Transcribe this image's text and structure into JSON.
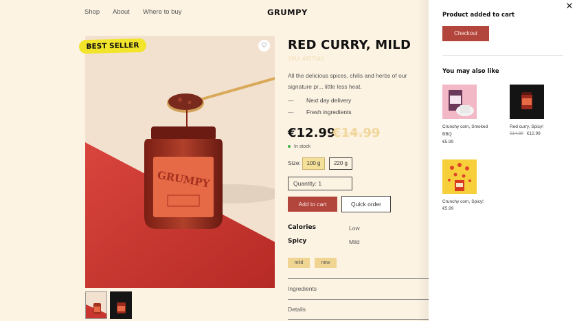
{
  "nav": {
    "links": [
      "Shop",
      "About",
      "Where to buy"
    ],
    "brand": "GRUMPY"
  },
  "product": {
    "badge": "BEST SELLER",
    "title": "RED CURRY, MILD",
    "sku": "SKU: 4837640",
    "description": "All the delicious spices, chilis and herbs of our signature pr... little less heat.",
    "features": [
      "Next day delivery",
      "Fresh ingredients"
    ],
    "price": "€12.99",
    "old_price": "€14.99",
    "stock": "In stock",
    "size_label": "Size:",
    "sizes": [
      "100 g",
      "220 g"
    ],
    "selected_size": "100 g",
    "quantity_label": "Quantity: 1",
    "add_to_cart": "Add to cart",
    "quick_order": "Quick order",
    "attributes": [
      {
        "label": "Calories",
        "value": "Low"
      },
      {
        "label": "Spicy",
        "value": "Mild"
      }
    ],
    "tags": [
      "mild",
      "new"
    ],
    "accordions": [
      "Ingredients",
      "Details"
    ]
  },
  "cart_panel": {
    "title": "Product added to cart",
    "checkout": "Checkout",
    "also_like": "You may also like",
    "recommendations": [
      {
        "name": "Crunchy corn, Smoked BBQ",
        "price": "€5.99",
        "old_price": ""
      },
      {
        "name": "Red curry, Spicy!",
        "price": "€12.99",
        "old_price": "€14.99"
      },
      {
        "name": "Crunchy corn, Spicy!",
        "price": "€5.99",
        "old_price": ""
      }
    ]
  },
  "colors": {
    "background": "#fdf3e3",
    "accent": "#b2453c",
    "badge": "#f2e42a",
    "tag": "#f0d592"
  },
  "icons": {
    "favorite": "heart-icon",
    "close": "close-icon",
    "stock": "dot-icon"
  }
}
